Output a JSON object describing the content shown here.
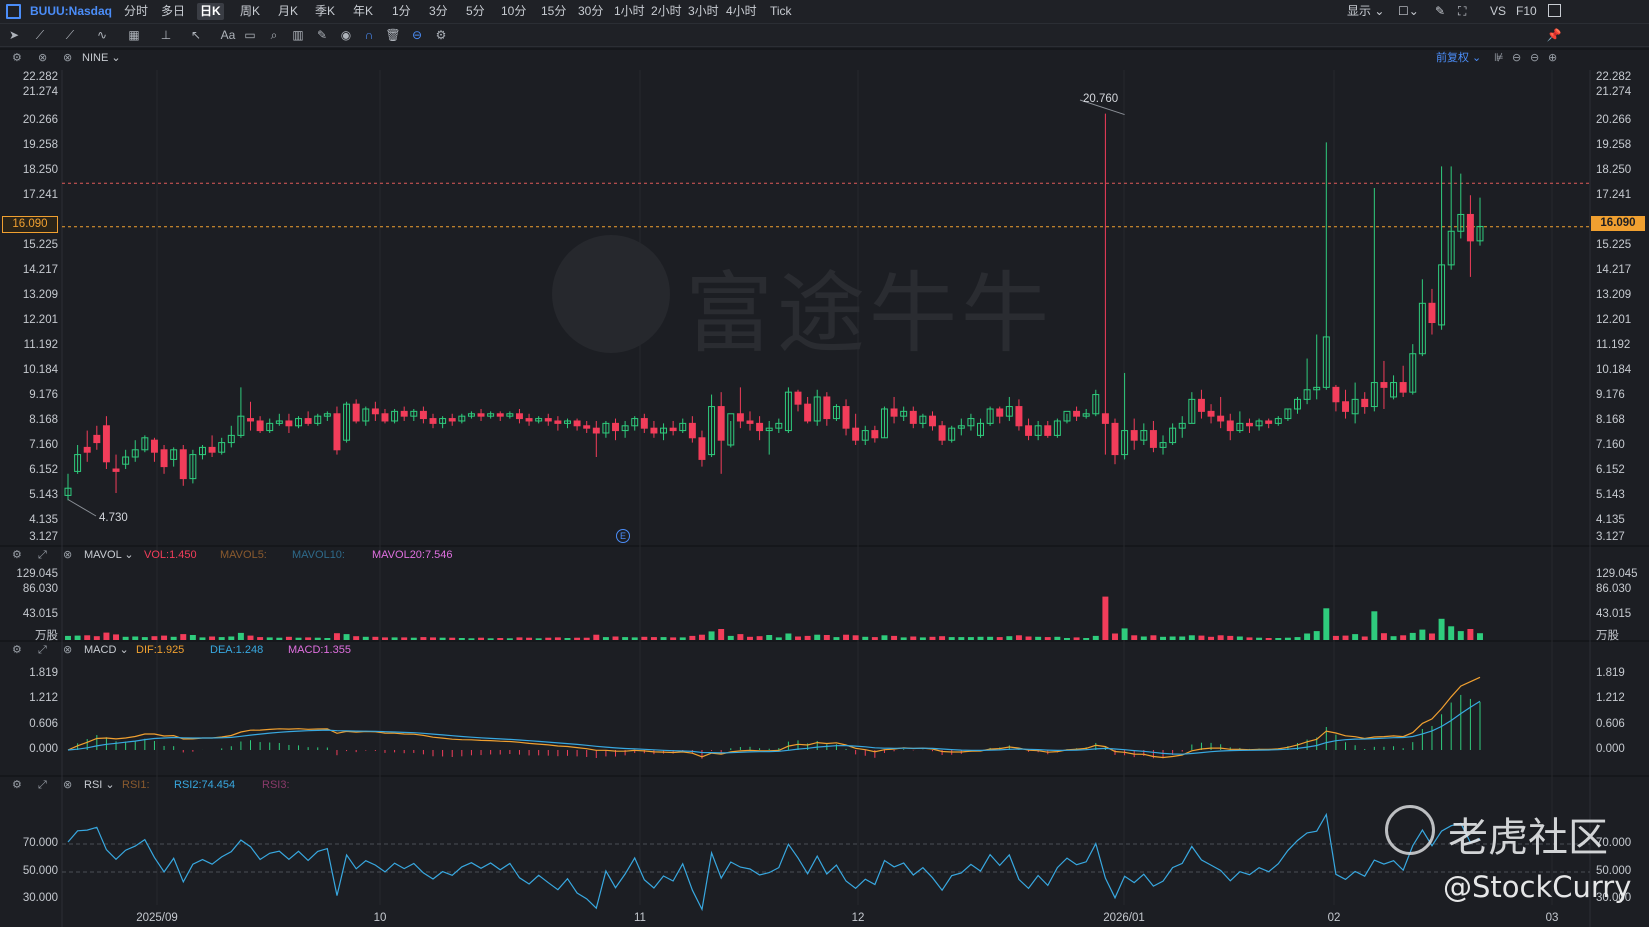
{
  "toolbar": {
    "symbol": "BUUU:Nasdaq",
    "periods": [
      "分时",
      "多日",
      "日K",
      "周K",
      "月K",
      "季K",
      "年K",
      "1分",
      "3分",
      "5分",
      "10分",
      "15分",
      "30分",
      "1小时",
      "2小时",
      "3小时",
      "4小时",
      "Tick"
    ],
    "active_period": "日K",
    "display_label": "显示",
    "vs_label": "VS",
    "f10_label": "F10"
  },
  "main_pane": {
    "indicator": "NINE",
    "adjust_label": "前复权",
    "y_ticks": [
      "22.282",
      "21.274",
      "20.266",
      "19.258",
      "18.250",
      "17.241",
      "16.090",
      "15.225",
      "14.217",
      "13.209",
      "12.201",
      "11.192",
      "10.184",
      "9.176",
      "8.168",
      "7.160",
      "6.152",
      "5.143",
      "4.135",
      "3.127"
    ],
    "current_price": "16.090",
    "high_annotation": "20.760",
    "low_annotation": "4.730",
    "event_marker": "E",
    "watermark": "富途牛牛",
    "colors": {
      "up": "#2fcc7d",
      "down": "#f23d5a",
      "price_line": "#f0a030",
      "resistance": "#e05a5a"
    }
  },
  "volume_pane": {
    "indicator": "MAVOL",
    "vol": "VOL:1.450",
    "mavol5": "MAVOL5:",
    "mavol10": "MAVOL10:",
    "mavol20": "MAVOL20:7.546",
    "y_ticks": [
      "129.045",
      "86.030",
      "43.015",
      "万股"
    ]
  },
  "macd_pane": {
    "indicator": "MACD",
    "dif": "DIF:1.925",
    "dea": "DEA:1.248",
    "macd": "MACD:1.355",
    "y_ticks": [
      "1.819",
      "1.212",
      "0.606",
      "0.000"
    ]
  },
  "rsi_pane": {
    "indicator": "RSI",
    "rsi1": "RSI1:",
    "rsi2": "RSI2:74.454",
    "rsi3": "RSI3:",
    "y_ticks": [
      "70.000",
      "50.000",
      "30.000"
    ]
  },
  "x_axis": [
    "2025/09",
    "10",
    "11",
    "12",
    "2026/01",
    "02",
    "03"
  ],
  "overlay": {
    "community_name": "老虎社区",
    "author": "@StockCurry"
  },
  "chart_data": {
    "type": "candlestick",
    "ylim": [
      3.127,
      22.282
    ],
    "candles": [
      [
        4.9,
        5.8,
        5.2,
        4.7
      ],
      [
        5.9,
        7.0,
        6.6,
        5.8
      ],
      [
        6.9,
        7.6,
        6.7,
        6.3
      ],
      [
        7.4,
        7.8,
        7.1,
        6.8
      ],
      [
        7.8,
        8.2,
        6.3,
        6.0
      ],
      [
        6.0,
        6.6,
        5.9,
        5.0
      ],
      [
        6.2,
        6.8,
        6.5,
        6.0
      ],
      [
        6.5,
        7.2,
        6.8,
        6.3
      ],
      [
        6.8,
        7.4,
        7.3,
        6.7
      ],
      [
        7.2,
        7.3,
        6.7,
        6.3
      ],
      [
        6.8,
        7.0,
        6.1,
        5.8
      ],
      [
        6.4,
        6.9,
        6.8,
        6.1
      ],
      [
        6.8,
        7.0,
        5.6,
        5.3
      ],
      [
        5.6,
        6.8,
        6.6,
        5.4
      ],
      [
        6.6,
        7.0,
        6.9,
        6.4
      ],
      [
        6.9,
        7.4,
        6.7,
        6.5
      ],
      [
        6.7,
        7.3,
        7.1,
        6.6
      ],
      [
        7.1,
        7.8,
        7.4,
        6.9
      ],
      [
        7.4,
        9.4,
        8.2,
        7.3
      ],
      [
        8.1,
        8.8,
        8.0,
        7.6
      ],
      [
        8.0,
        8.2,
        7.6,
        7.5
      ],
      [
        7.6,
        8.1,
        7.9,
        7.5
      ],
      [
        7.9,
        8.3,
        8.0,
        7.8
      ],
      [
        8.0,
        8.3,
        7.8,
        7.5
      ],
      [
        7.8,
        8.2,
        8.1,
        7.7
      ],
      [
        8.1,
        8.4,
        7.9,
        7.8
      ],
      [
        7.9,
        8.3,
        8.2,
        7.8
      ],
      [
        8.2,
        8.4,
        8.3,
        8.0
      ],
      [
        8.3,
        8.6,
        6.8,
        6.6
      ],
      [
        7.2,
        8.8,
        8.7,
        7.1
      ],
      [
        8.7,
        8.9,
        8.0,
        7.9
      ],
      [
        8.0,
        8.6,
        8.5,
        7.8
      ],
      [
        8.5,
        8.8,
        8.3,
        8.0
      ],
      [
        8.3,
        8.5,
        8.0,
        7.9
      ],
      [
        8.0,
        8.5,
        8.4,
        7.9
      ],
      [
        8.4,
        8.6,
        8.2,
        8.0
      ],
      [
        8.2,
        8.5,
        8.4,
        8.0
      ],
      [
        8.4,
        8.6,
        8.1,
        7.9
      ],
      [
        8.1,
        8.3,
        7.9,
        7.7
      ],
      [
        7.9,
        8.2,
        8.1,
        7.7
      ],
      [
        8.1,
        8.3,
        8.0,
        7.8
      ],
      [
        8.0,
        8.3,
        8.2,
        7.9
      ],
      [
        8.2,
        8.4,
        8.3,
        8.1
      ],
      [
        8.3,
        8.5,
        8.2,
        8.0
      ],
      [
        8.2,
        8.4,
        8.3,
        8.1
      ],
      [
        8.3,
        8.4,
        8.2,
        8.0
      ],
      [
        8.2,
        8.4,
        8.3,
        8.1
      ],
      [
        8.3,
        8.5,
        8.1,
        7.9
      ],
      [
        8.1,
        8.3,
        8.0,
        7.8
      ],
      [
        8.0,
        8.2,
        8.1,
        7.9
      ],
      [
        8.1,
        8.3,
        8.0,
        7.8
      ],
      [
        8.0,
        8.2,
        7.9,
        7.6
      ],
      [
        7.9,
        8.1,
        8.0,
        7.7
      ],
      [
        8.0,
        8.1,
        7.8,
        7.6
      ],
      [
        7.8,
        8.0,
        7.7,
        7.5
      ],
      [
        7.7,
        8.0,
        7.5,
        6.5
      ],
      [
        7.5,
        8.0,
        7.9,
        7.3
      ],
      [
        7.9,
        8.1,
        7.6,
        7.2
      ],
      [
        7.6,
        8.0,
        7.8,
        7.3
      ],
      [
        7.8,
        8.2,
        8.1,
        7.6
      ],
      [
        8.1,
        8.3,
        7.7,
        7.5
      ],
      [
        7.7,
        8.0,
        7.5,
        7.3
      ],
      [
        7.5,
        7.9,
        7.7,
        7.2
      ],
      [
        7.7,
        8.0,
        7.6,
        7.4
      ],
      [
        7.6,
        8.1,
        7.9,
        7.5
      ],
      [
        7.9,
        8.2,
        7.3,
        7.1
      ],
      [
        7.3,
        7.6,
        6.4,
        6.1
      ],
      [
        6.6,
        9.1,
        8.6,
        6.5
      ],
      [
        8.6,
        9.2,
        7.2,
        5.8
      ],
      [
        7.0,
        8.0,
        8.3,
        6.9
      ],
      [
        8.3,
        9.4,
        8.0,
        7.7
      ],
      [
        8.0,
        8.4,
        7.9,
        7.6
      ],
      [
        7.9,
        8.2,
        7.6,
        7.2
      ],
      [
        7.6,
        8.0,
        7.7,
        6.6
      ],
      [
        7.7,
        8.1,
        7.9,
        7.5
      ],
      [
        7.6,
        9.4,
        9.2,
        7.5
      ],
      [
        9.2,
        9.3,
        8.7,
        8.4
      ],
      [
        8.7,
        9.0,
        8.0,
        7.9
      ],
      [
        8.0,
        9.3,
        9.0,
        7.8
      ],
      [
        9.0,
        9.2,
        8.1,
        7.8
      ],
      [
        8.1,
        8.7,
        8.6,
        8.0
      ],
      [
        8.6,
        8.9,
        7.7,
        7.4
      ],
      [
        7.7,
        8.3,
        7.2,
        7.0
      ],
      [
        7.2,
        7.8,
        7.6,
        7.0
      ],
      [
        7.6,
        7.8,
        7.3,
        7.1
      ],
      [
        7.3,
        8.6,
        8.5,
        7.3
      ],
      [
        8.5,
        9.0,
        8.2,
        7.9
      ],
      [
        8.2,
        8.6,
        8.4,
        8.0
      ],
      [
        8.4,
        8.6,
        7.9,
        7.7
      ],
      [
        7.9,
        8.3,
        8.2,
        7.7
      ],
      [
        8.2,
        8.4,
        7.8,
        7.6
      ],
      [
        7.8,
        8.0,
        7.2,
        7.0
      ],
      [
        7.2,
        7.8,
        7.7,
        7.1
      ],
      [
        7.7,
        8.1,
        7.8,
        7.4
      ],
      [
        7.8,
        8.3,
        8.1,
        7.6
      ],
      [
        7.4,
        8.1,
        7.9,
        7.3
      ],
      [
        7.9,
        8.6,
        8.5,
        7.8
      ],
      [
        8.5,
        8.6,
        8.2,
        7.9
      ],
      [
        8.2,
        9.0,
        8.6,
        8.0
      ],
      [
        8.6,
        8.9,
        7.8,
        7.6
      ],
      [
        7.8,
        8.1,
        7.4,
        7.2
      ],
      [
        7.4,
        8.0,
        7.8,
        7.2
      ],
      [
        7.8,
        8.0,
        7.4,
        7.3
      ],
      [
        7.4,
        8.1,
        8.0,
        7.3
      ],
      [
        8.0,
        8.3,
        8.4,
        7.9
      ],
      [
        8.4,
        8.6,
        8.2,
        8.0
      ],
      [
        8.2,
        8.5,
        8.3,
        8.1
      ],
      [
        8.3,
        9.3,
        9.1,
        8.2
      ],
      [
        8.3,
        20.8,
        7.9,
        6.6
      ],
      [
        7.9,
        8.1,
        6.6,
        6.2
      ],
      [
        6.6,
        10.0,
        7.6,
        6.4
      ],
      [
        7.6,
        8.1,
        7.2,
        6.8
      ],
      [
        7.2,
        7.9,
        7.6,
        7.0
      ],
      [
        7.6,
        8.0,
        6.9,
        6.7
      ],
      [
        6.9,
        7.4,
        7.1,
        6.6
      ],
      [
        7.1,
        7.9,
        7.7,
        7.0
      ],
      [
        7.7,
        8.2,
        7.9,
        7.3
      ],
      [
        7.9,
        9.2,
        8.9,
        7.9
      ],
      [
        8.9,
        9.3,
        8.4,
        8.1
      ],
      [
        8.4,
        8.7,
        8.2,
        7.9
      ],
      [
        8.2,
        9.0,
        8.0,
        7.7
      ],
      [
        8.0,
        8.3,
        7.6,
        7.2
      ],
      [
        7.6,
        8.4,
        7.9,
        7.5
      ],
      [
        7.9,
        8.1,
        7.8,
        7.5
      ],
      [
        7.8,
        8.1,
        8.0,
        7.6
      ],
      [
        8.0,
        8.1,
        7.9,
        7.7
      ],
      [
        7.9,
        8.2,
        8.1,
        7.8
      ],
      [
        8.1,
        8.5,
        8.5,
        8.0
      ],
      [
        8.5,
        9.0,
        8.9,
        8.3
      ],
      [
        8.9,
        10.6,
        9.3,
        8.7
      ],
      [
        9.3,
        11.6,
        9.4,
        8.9
      ],
      [
        9.4,
        19.6,
        11.5,
        9.3
      ],
      [
        9.4,
        9.5,
        8.8,
        8.4
      ],
      [
        8.8,
        9.3,
        8.4,
        8.1
      ],
      [
        8.3,
        9.6,
        8.9,
        7.9
      ],
      [
        8.9,
        9.2,
        8.6,
        8.3
      ],
      [
        8.6,
        17.7,
        9.6,
        8.4
      ],
      [
        9.6,
        10.5,
        9.4,
        8.5
      ],
      [
        9.0,
        9.9,
        9.6,
        8.9
      ],
      [
        9.6,
        10.3,
        9.2,
        9.0
      ],
      [
        9.2,
        11.2,
        10.8,
        9.1
      ],
      [
        10.8,
        13.9,
        12.9,
        10.7
      ],
      [
        12.9,
        13.5,
        12.1,
        11.6
      ],
      [
        12.0,
        18.6,
        14.5,
        11.8
      ],
      [
        14.5,
        18.6,
        15.9,
        14.3
      ],
      [
        15.9,
        18.3,
        16.6,
        15.6
      ],
      [
        16.6,
        17.4,
        15.5,
        14.0
      ],
      [
        15.5,
        17.3,
        16.1,
        15.3
      ]
    ],
    "annotations": [
      "20.760",
      "4.730"
    ],
    "price_lines": [
      17.9,
      16.09
    ]
  }
}
